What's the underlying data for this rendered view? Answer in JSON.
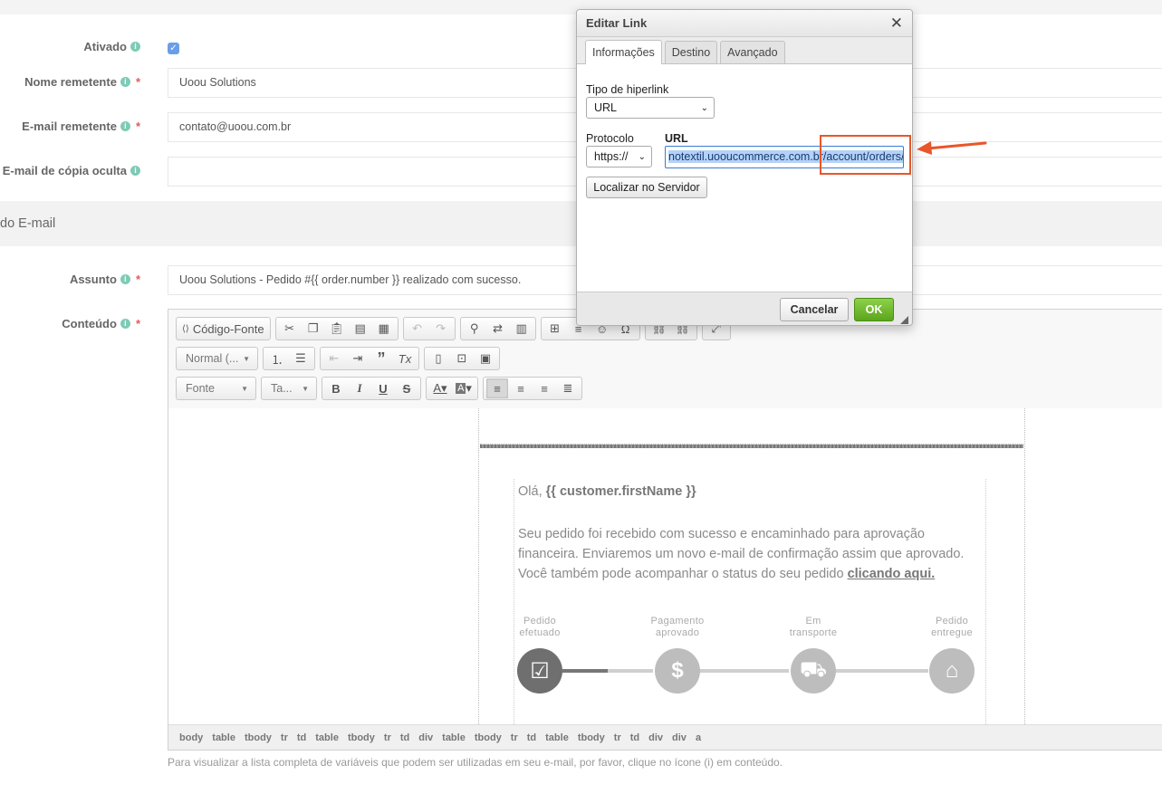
{
  "form": {
    "ativado": {
      "label": "Ativado",
      "checked": true
    },
    "nome_remetente": {
      "label": "Nome remetente",
      "value": "Uoou Solutions"
    },
    "email_remetente": {
      "label": "E-mail remetente",
      "value": "contato@uoou.com.br"
    },
    "email_bcc": {
      "label": "E-mail de cópia oculta",
      "value": ""
    },
    "section_title": "do E-mail",
    "assunto": {
      "label": "Assunto",
      "value": "Uoou Solutions - Pedido #{{ order.number }} realizado com sucesso."
    },
    "conteudo": {
      "label": "Conteúdo"
    },
    "required_mark": "*",
    "info_glyph": "i"
  },
  "toolbar": {
    "source_label": "Código-Fonte",
    "format_combo": "Normal (...",
    "font_combo": "Fonte",
    "size_combo": "Ta..."
  },
  "editor_content": {
    "greeting_prefix": "Olá, ",
    "greeting_var": "{{ customer.firstName }}",
    "paragraph": "Seu pedido foi recebido com sucesso e encaminhado para aprovação financeira. Enviaremos um novo e-mail de confirmação assim que aprovado. Você também pode acompanhar o status do seu pedido ",
    "link_text": "clicando aqui.",
    "steps": [
      {
        "label_line1": "Pedido",
        "label_line2": "efetuado",
        "icon": "check-icon",
        "done": true
      },
      {
        "label_line1": "Pagamento",
        "label_line2": "aprovado",
        "icon": "dollar-icon",
        "done": false
      },
      {
        "label_line1": "Em",
        "label_line2": "transporte",
        "icon": "truck-icon",
        "done": false
      },
      {
        "label_line1": "Pedido",
        "label_line2": "entregue",
        "icon": "home-icon",
        "done": false
      }
    ]
  },
  "pathbar": [
    "body",
    "table",
    "tbody",
    "tr",
    "td",
    "table",
    "tbody",
    "tr",
    "td",
    "div",
    "table",
    "tbody",
    "tr",
    "td",
    "table",
    "tbody",
    "tr",
    "td",
    "div",
    "div",
    "a"
  ],
  "hint": "Para visualizar a lista completa de variáveis que podem ser utilizadas em seu e-mail, por favor, clique no ícone (i) em conteúdo.",
  "dialog": {
    "title": "Editar Link",
    "close_glyph": "✕",
    "tabs": [
      "Informações",
      "Destino",
      "Avançado"
    ],
    "tipo_label": "Tipo de hiperlink",
    "tipo_value": "URL",
    "protocolo_label": "Protocolo",
    "protocolo_value": "https://",
    "url_label": "URL",
    "url_value": "notextil.uooucommerce.com.br/account/orders/",
    "browse_button": "Localizar no Servidor",
    "cancel_button": "Cancelar",
    "ok_button": "OK"
  },
  "colors": {
    "accent_ok": "#5aa51c",
    "annotation": "#e8562a",
    "info_icon": "#7ecbb5",
    "required": "#e05c5c"
  }
}
